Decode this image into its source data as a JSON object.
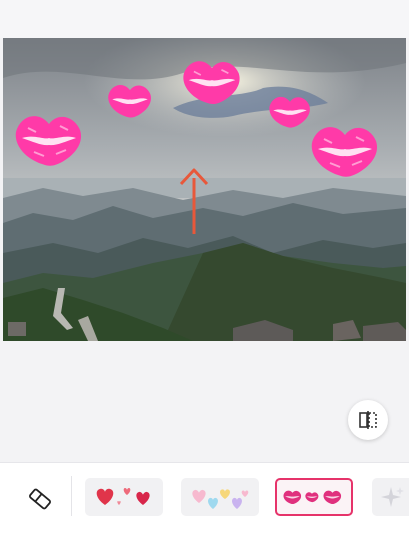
{
  "screen": {
    "accent_color": "#e6336a",
    "background_color": "#f3f3f5"
  },
  "photo": {
    "sticker_icon": "kiss-lips-icon",
    "sticker_color": "#ff3aa8",
    "drag_hint_icon": "up-arrow-icon",
    "drag_hint_color": "#e8583a"
  },
  "compare_button": {
    "icon": "compare-split-icon"
  },
  "sticker_tray": {
    "eraser_icon": "eraser-icon",
    "items": [
      {
        "icon": "red-hearts-sticker-icon",
        "selected": false
      },
      {
        "icon": "pastel-hearts-sticker-icon",
        "selected": false
      },
      {
        "icon": "kiss-lips-sticker-icon",
        "selected": true
      },
      {
        "icon": "sparkle-sticker-icon",
        "selected": false
      }
    ]
  }
}
